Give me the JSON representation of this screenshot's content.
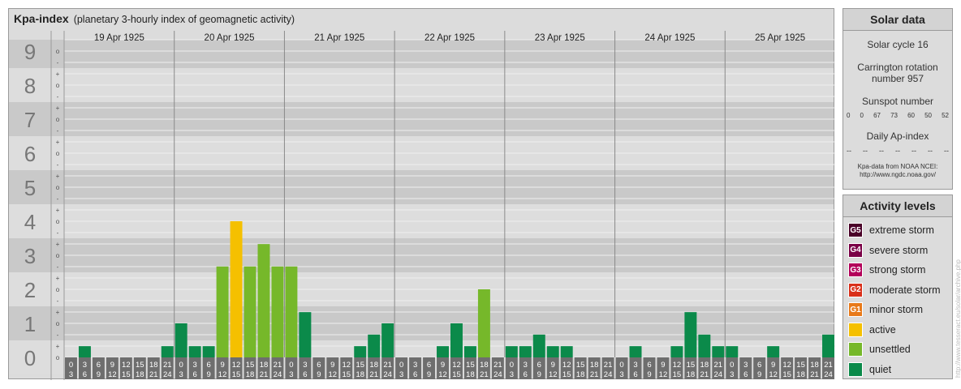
{
  "header": {
    "title": "Kpa-index",
    "subtitle": "(planetary 3-hourly index of geomagnetic activity)"
  },
  "chart_data": {
    "type": "bar",
    "days": [
      "19 Apr 1925",
      "20 Apr 1925",
      "21 Apr 1925",
      "22 Apr 1925",
      "23 Apr 1925",
      "24 Apr 1925",
      "25 Apr 1925"
    ],
    "interval_labels": [
      [
        "0",
        "3"
      ],
      [
        "3",
        "6"
      ],
      [
        "6",
        "9"
      ],
      [
        "9",
        "12"
      ],
      [
        "12",
        "15"
      ],
      [
        "15",
        "18"
      ],
      [
        "18",
        "21"
      ],
      [
        "21",
        "24"
      ]
    ],
    "y_major_labels": [
      "0",
      "1",
      "2",
      "3",
      "4",
      "5",
      "6",
      "7",
      "8",
      "9"
    ],
    "y_minor_labels": [
      "+",
      "o",
      "-"
    ],
    "ylim": [
      0,
      9.33
    ],
    "grid": true,
    "values": [
      [
        0,
        0.33,
        0,
        0,
        0,
        0,
        0,
        0.33
      ],
      [
        1,
        0.33,
        0.33,
        2.67,
        4,
        2.67,
        3.33,
        2.67
      ],
      [
        2.67,
        1.33,
        0,
        0,
        0,
        0.33,
        0.67,
        1
      ],
      [
        0,
        0,
        0,
        0.33,
        1,
        0.33,
        2,
        0
      ],
      [
        0.33,
        0.33,
        0.67,
        0.33,
        0.33,
        0,
        0,
        0
      ],
      [
        0,
        0.33,
        0,
        0,
        0.33,
        1.33,
        0.67,
        0.33
      ],
      [
        0.33,
        0,
        0,
        0.33,
        0,
        0,
        0,
        0.67
      ]
    ],
    "colors": {
      "quiet": "#0b8a4a",
      "unsettled": "#76b82a",
      "active": "#f5c000"
    }
  },
  "solar": {
    "title": "Solar data",
    "cycle": "Solar cycle 16",
    "carrington_line1": "Carrington rotation",
    "carrington_line2": "number 957",
    "sunspot_title": "Sunspot number",
    "sunspot_values": [
      "0",
      "0",
      "67",
      "73",
      "60",
      "50",
      "52"
    ],
    "ap_title": "Daily Ap-index",
    "ap_values": [
      "--",
      "--",
      "--",
      "--",
      "--",
      "--",
      "--"
    ],
    "source_line1": "Kpa-data from NOAA NCEI:",
    "source_line2": "http://www.ngdc.noaa.gov/"
  },
  "levels": {
    "title": "Activity levels",
    "items": [
      {
        "badge": "G5",
        "label": "extreme storm",
        "color": "#4a0028"
      },
      {
        "badge": "G4",
        "label": "severe storm",
        "color": "#7a0046"
      },
      {
        "badge": "G3",
        "label": "strong storm",
        "color": "#b3005a"
      },
      {
        "badge": "G2",
        "label": "moderate storm",
        "color": "#d9301a"
      },
      {
        "badge": "G1",
        "label": "minor storm",
        "color": "#e87a1a"
      },
      {
        "badge": "",
        "label": "active",
        "color": "#f5c000"
      },
      {
        "badge": "",
        "label": "unsettled",
        "color": "#76b82a"
      },
      {
        "badge": "",
        "label": "quiet",
        "color": "#0b8a4a"
      }
    ]
  },
  "credit": "http://www.tesseract.eu/solar/archive.php"
}
